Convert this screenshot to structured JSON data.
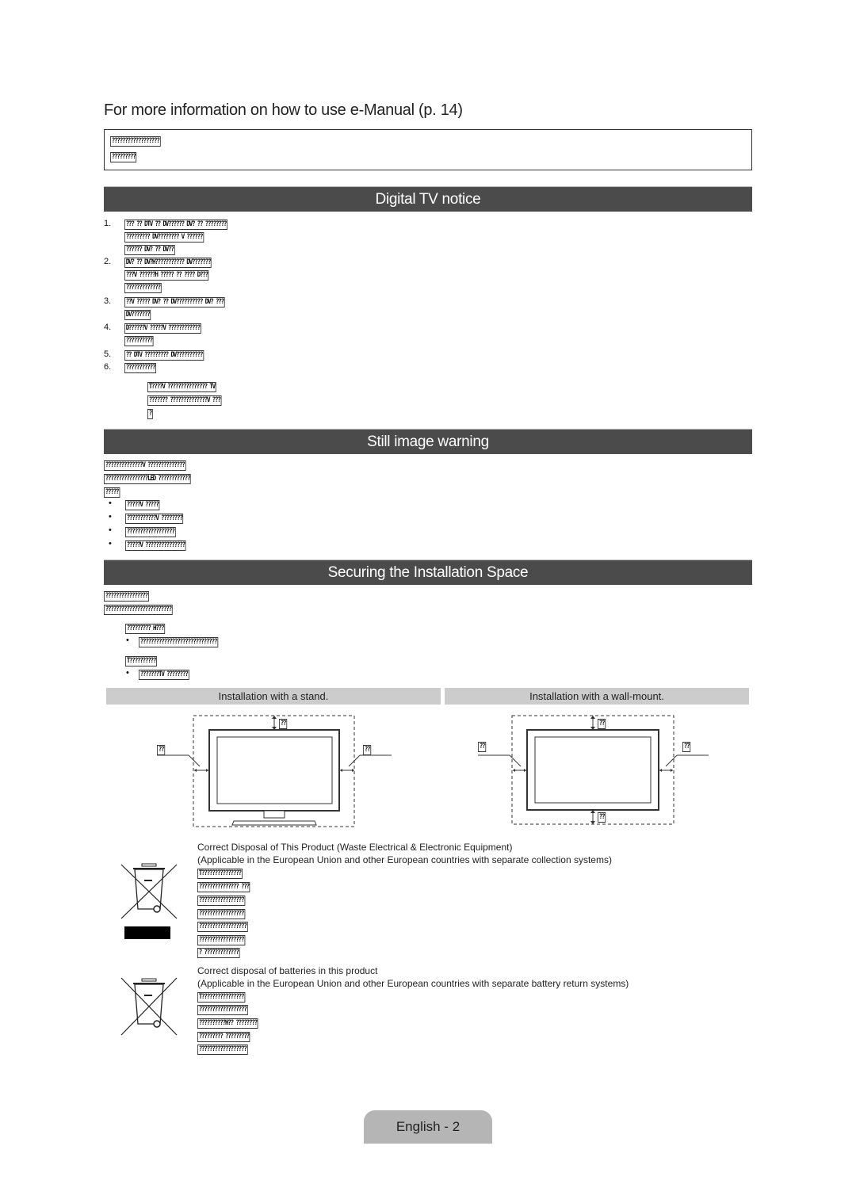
{
  "header": {
    "title": "For more information on how to use e-Manual (p. 14)",
    "note_lines": [
      "??????????????????",
      "?????????"
    ]
  },
  "digital_tv": {
    "heading": "Digital TV notice",
    "items": [
      {
        "num": "1.",
        "lines": [
          "??? ?? DTV ?? DV?????? DV? ?? ????????",
          "????????? DV???????? V ??????",
          "?????? DV? ?? DV??"
        ]
      },
      {
        "num": "2.",
        "lines": [
          "DV? ?? DV?H??????????? DV???????",
          "???V ??????H ????? ?? ???? D???",
          "?????????????"
        ]
      },
      {
        "num": "3.",
        "lines": [
          "??V ????? DV? ?? DV?????????? DV? ???",
          "DV???????"
        ]
      },
      {
        "num": "4.",
        "lines": [
          "D??????V ?????V ????????????",
          "??????????"
        ]
      },
      {
        "num": "5.",
        "lines": [
          "?? DTV ????????? DV??????????"
        ]
      },
      {
        "num": "6.",
        "lines": [
          "???????????"
        ]
      }
    ],
    "note_lines": [
      "T????V ??????????????? TV",
      "??????? ??????????????V ???",
      "?"
    ]
  },
  "still_image": {
    "heading": "Still image warning",
    "para_lines": [
      "??????????????V ??????????????",
      "????????????????LED ????????????",
      "?????"
    ],
    "bullets": [
      "?????V ?????",
      "???????????V ????????",
      "??????????????????",
      "?????V ???????????????"
    ]
  },
  "installation": {
    "heading": "Securing the Installation Space",
    "para_lines": [
      "????????????????",
      "?????????????????????????"
    ],
    "sub1_title": "????????? H???",
    "sub1_bullets": [
      "?????????????????????????????"
    ],
    "sub2_title": "T??????????",
    "sub2_bullets": [
      "???????TV ????????"
    ],
    "stand_label": "Installation with a stand.",
    "wall_label": "Installation with a wall-mount.",
    "dim_label": "??"
  },
  "weee": {
    "title": "Correct Disposal of This Product (Waste Electrical & Electronic Equipment)",
    "subtitle": "(Applicable in the European Union and other European countries with separate collection systems)",
    "lines": [
      "T???????????????",
      "??????????????? ???",
      "?????????????????",
      "?????????????????",
      "??????????????????",
      "?????????????????",
      "? ?????????????"
    ]
  },
  "battery": {
    "title": "Correct disposal of batteries in this product",
    "subtitle": "(Applicable in the European Union and other European countries with separate battery return systems)",
    "lines": [
      "T????????????????",
      "??????????????????",
      "??????????H?? ????????",
      "????????? ?????????",
      "??????????????????"
    ]
  },
  "footer": {
    "page_label": "English - 2"
  }
}
